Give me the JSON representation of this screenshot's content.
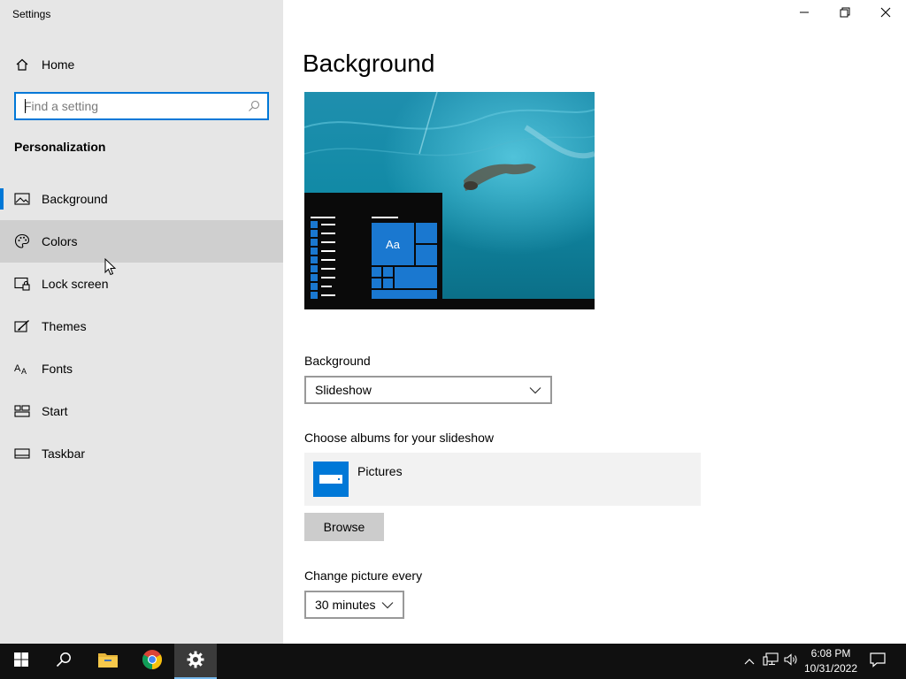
{
  "window": {
    "title": "Settings",
    "controls": [
      "minimize-icon",
      "restore-icon",
      "close-icon"
    ]
  },
  "sidebar": {
    "home_label": "Home",
    "search": {
      "placeholder": "Find a setting",
      "value": ""
    },
    "section_title": "Personalization",
    "selected": "Background",
    "hovered": "Colors",
    "items": [
      {
        "label": "Background",
        "icon": "picture-icon"
      },
      {
        "label": "Colors",
        "icon": "palette-icon"
      },
      {
        "label": "Lock screen",
        "icon": "lock-screen-icon"
      },
      {
        "label": "Themes",
        "icon": "brush-icon"
      },
      {
        "label": "Fonts",
        "icon": "font-icon"
      },
      {
        "label": "Start",
        "icon": "start-icon"
      },
      {
        "label": "Taskbar",
        "icon": "taskbar-icon"
      }
    ]
  },
  "main": {
    "title": "Background",
    "preview": {
      "tile_text": "Aa"
    },
    "background_label": "Background",
    "background_value": "Slideshow",
    "albums_label": "Choose albums for your slideshow",
    "album_name": "Pictures",
    "browse_label": "Browse",
    "interval_label": "Change picture every",
    "interval_value": "30 minutes"
  },
  "taskbar": {
    "apps": [
      "start-icon",
      "search-icon",
      "file-explorer-icon",
      "chrome-icon",
      "settings-icon"
    ],
    "active_app": "settings-icon",
    "tray_icons": [
      "chevron-up-icon",
      "network-icon",
      "volume-icon"
    ],
    "time": "6:08 PM",
    "date": "10/31/2022",
    "notification_icon": "action-center-icon"
  },
  "colors": {
    "accent": "#0078d7",
    "sidebar_bg": "#e6e6e6",
    "taskbar_bg": "#101010"
  }
}
